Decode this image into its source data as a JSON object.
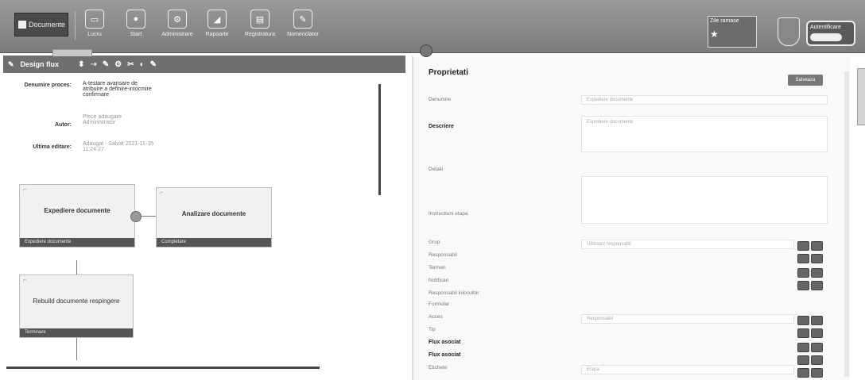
{
  "toolbar": {
    "logo_label": "Documente",
    "items": [
      {
        "label": "Lucru",
        "icon": "monitor-icon",
        "glyph": "▭"
      },
      {
        "label": "Start",
        "icon": "play-icon",
        "glyph": "●"
      },
      {
        "label": "Administrare",
        "icon": "gear-icon",
        "glyph": "⚙"
      },
      {
        "label": "Rapoarte",
        "icon": "chart-icon",
        "glyph": "◢"
      },
      {
        "label": "Registratura",
        "icon": "book-icon",
        "glyph": "▤"
      },
      {
        "label": "Nomenclator",
        "icon": "pencil-icon",
        "glyph": "✎"
      }
    ],
    "badge_text": "Zile ramase",
    "shield_text": "",
    "login_text": "Autentificare"
  },
  "left_panel": {
    "header_title": "Design flux",
    "tools": [
      "⬍",
      "➝",
      "✎",
      "⚙",
      "✂",
      "◐",
      "✎"
    ],
    "info": [
      {
        "label": "Denumire proces:",
        "value": "A-testare avansare de atribuire a definire-intocmire confirmare",
        "light": false
      },
      {
        "label": "Autor:",
        "value": "Plece adaugare Administrator",
        "light": true
      },
      {
        "label": "Ultima editare:",
        "value": "Adaugat - Salvat 2021-11-15 11:24:27",
        "light": true
      }
    ],
    "nodes": [
      {
        "title": "Expediere documente",
        "footer": "Expediere documente"
      },
      {
        "title": "Analizare documente",
        "footer": "Completare"
      },
      {
        "title": "Rebuild documente respingere",
        "footer": "Terminare"
      }
    ]
  },
  "properties": {
    "title": "Proprietati",
    "save_label": "Salveaza",
    "fields": [
      {
        "label": "Denumire",
        "value": "Expediere documente",
        "bold": false
      },
      {
        "label": "Descriere",
        "value": "Expediere documente",
        "bold": true
      },
      {
        "label": "Detalii",
        "value": "",
        "bold": false
      },
      {
        "label": "Instructiuni etapa",
        "value": "",
        "bold": false
      },
      {
        "label": "Grup",
        "value": "Utilizator responsabil",
        "bold": false
      },
      {
        "label": "Responsabil",
        "value": "",
        "bold": false
      },
      {
        "label": "Termen",
        "value": "",
        "bold": false
      },
      {
        "label": "Notificari",
        "value": "",
        "bold": false
      },
      {
        "label": "Responsabil inlocuitor",
        "value": "",
        "bold": false
      },
      {
        "label": "Formular",
        "value": "",
        "bold": false
      },
      {
        "label": "Acces",
        "value": "Responsabil",
        "bold": false
      },
      {
        "label": "Tip",
        "value": "",
        "bold": false
      },
      {
        "label": "Flux asociat",
        "value": "",
        "bold": true
      },
      {
        "label": "Flux asociat",
        "value": "",
        "bold": true
      },
      {
        "label": "Etichete",
        "value": "Etapa",
        "bold": false
      }
    ]
  }
}
